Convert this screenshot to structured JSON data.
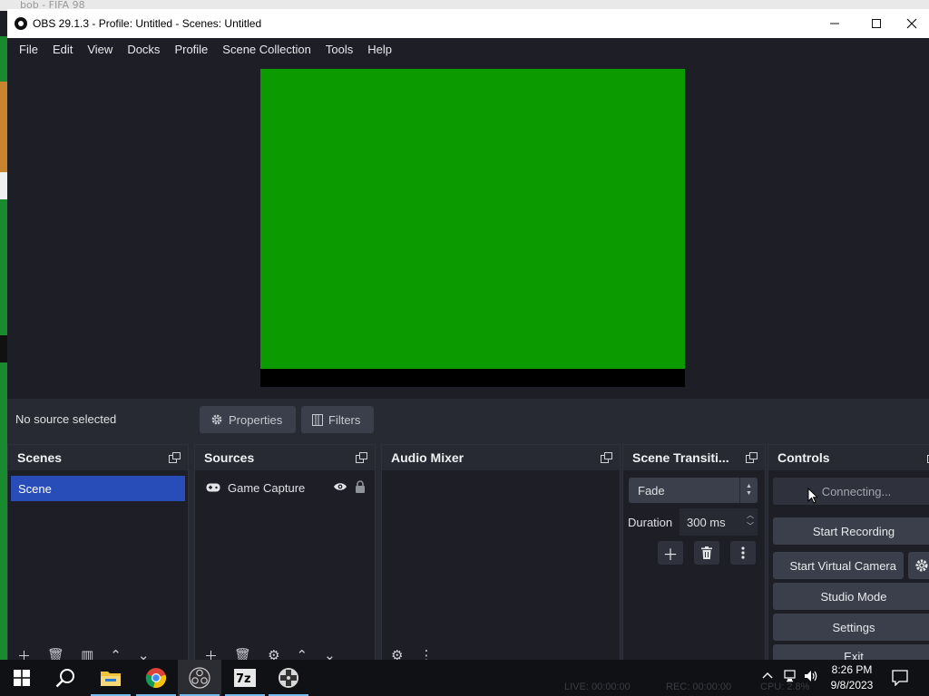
{
  "background": {
    "window_title": "bob - FIFA 98"
  },
  "window": {
    "title": "OBS 29.1.3 - Profile: Untitled - Scenes: Untitled"
  },
  "menu": [
    "File",
    "Edit",
    "View",
    "Docks",
    "Profile",
    "Scene Collection",
    "Tools",
    "Help"
  ],
  "context_bar": {
    "status": "No source selected",
    "properties": "Properties",
    "filters": "Filters"
  },
  "docks": {
    "scenes": {
      "title": "Scenes",
      "items": [
        "Scene"
      ]
    },
    "sources": {
      "title": "Sources",
      "items": [
        {
          "name": "Game Capture",
          "icon": "gamepad-icon"
        }
      ]
    },
    "audio_mixer": {
      "title": "Audio Mixer"
    },
    "transitions": {
      "title": "Scene Transiti...",
      "selected": "Fade",
      "duration_label": "Duration",
      "duration_value": "300 ms"
    },
    "controls": {
      "title": "Controls",
      "buttons": [
        "Connecting...",
        "Start Recording",
        "Start Virtual Camera",
        "Studio Mode",
        "Settings",
        "Exit"
      ]
    }
  },
  "taskbar": {
    "status_live": "LIVE: 00:00:00",
    "status_rec": "REC: 00:00:00",
    "status_cpu": "CPU: 2.8%",
    "time": "8:26 PM",
    "date": "9/8/2023"
  },
  "colors": {
    "canvas": "#0b9b00",
    "scene_selected": "#284cb8",
    "accent": "#76b9ed"
  }
}
